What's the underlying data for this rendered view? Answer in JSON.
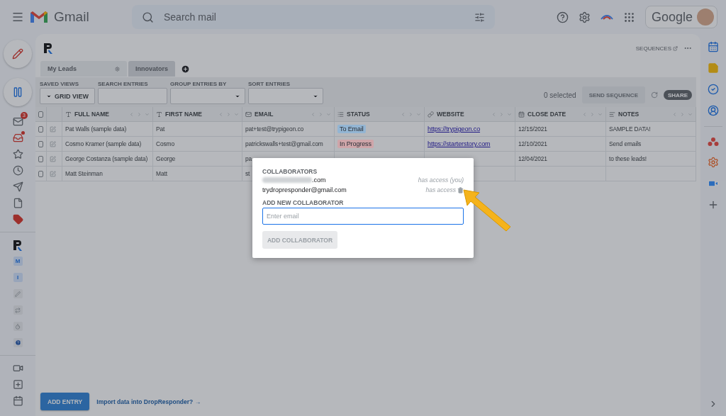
{
  "topbar": {
    "app_name": "Gmail",
    "search": {
      "placeholder": "Search mail"
    },
    "account_label": "Google"
  },
  "rail": {
    "mail_badge": "3",
    "app_badges": [
      {
        "label": "M"
      },
      {
        "label": "I"
      }
    ]
  },
  "app": {
    "sequences_link": "SEQUENCES",
    "tabs": [
      {
        "label": "My Leads",
        "selected": false
      },
      {
        "label": "Innovators",
        "selected": true
      }
    ],
    "filters": {
      "saved_views_label": "SAVED VIEWS",
      "saved_view": "GRID VIEW",
      "search_label": "SEARCH ENTRIES",
      "group_label": "GROUP ENTRIES BY",
      "sort_label": "SORT ENTRIES"
    },
    "selected_count": "0 selected",
    "send_button": "SEND SEQUENCE",
    "share_button": "SHARE",
    "table": {
      "all_checked": false,
      "columns": [
        {
          "label": "FULL NAME",
          "kind": "text"
        },
        {
          "label": "FIRST NAME",
          "kind": "text"
        },
        {
          "label": "EMAIL",
          "kind": "email"
        },
        {
          "label": "STATUS",
          "kind": "select"
        },
        {
          "label": "WEBSITE",
          "kind": "link"
        },
        {
          "label": "CLOSE DATE",
          "kind": "date"
        },
        {
          "label": "NOTES",
          "kind": "notes"
        }
      ],
      "rows": [
        {
          "checked": false,
          "cells": [
            {
              "kind": "text",
              "text": "Pat Walls (sample data)"
            },
            {
              "kind": "text",
              "text": "Pat"
            },
            {
              "kind": "text",
              "text": "pat+test@trypigeon.co"
            },
            {
              "kind": "tag",
              "text": "To Email",
              "color": "#93b5d3"
            },
            {
              "kind": "link",
              "text": "https://trypigeon.co"
            },
            {
              "kind": "text",
              "text": "12/15/2021"
            },
            {
              "kind": "text",
              "text": "SAMPLE DATA!"
            }
          ]
        },
        {
          "checked": false,
          "cells": [
            {
              "kind": "text",
              "text": "Cosmo Kramer (sample data)"
            },
            {
              "kind": "text",
              "text": "Cosmo"
            },
            {
              "kind": "text",
              "text": "patrickswalls+test@gmail.com"
            },
            {
              "kind": "tag",
              "text": "In Progress",
              "color": "#cfa5a9"
            },
            {
              "kind": "link",
              "text": "https://starterstory.com"
            },
            {
              "kind": "text",
              "text": "12/10/2021"
            },
            {
              "kind": "text",
              "text": "Send emails"
            }
          ]
        },
        {
          "checked": false,
          "cells": [
            {
              "kind": "text",
              "text": "George Costanza (sample data)"
            },
            {
              "kind": "text",
              "text": "George"
            },
            {
              "kind": "text",
              "text": "pa"
            },
            null,
            null,
            {
              "kind": "text",
              "text": "12/04/2021"
            },
            {
              "kind": "text",
              "text": "to these leads!"
            }
          ]
        },
        {
          "checked": false,
          "cells": [
            {
              "kind": "text",
              "text": "Matt Steinman"
            },
            {
              "kind": "text",
              "text": "Matt"
            },
            {
              "kind": "text",
              "text": "st"
            },
            null,
            null,
            null,
            null
          ]
        }
      ]
    },
    "add_entry": "ADD ENTRY",
    "import_link": "Import data into DropResponder? →"
  },
  "dialog": {
    "title": "COLLABORATORS",
    "collaborators": [
      {
        "kind": "masked",
        "email": ".com",
        "access": "has access (you)",
        "removable": false
      },
      {
        "kind": "plain",
        "email": "trydropresponder@gmail.com",
        "access": "has access",
        "removable": true
      }
    ],
    "add_label": "ADD NEW COLLABORATOR",
    "email_field": {
      "placeholder": "Enter email"
    },
    "add_button": {
      "label": "ADD COLLABORATOR",
      "disabled": true
    }
  }
}
